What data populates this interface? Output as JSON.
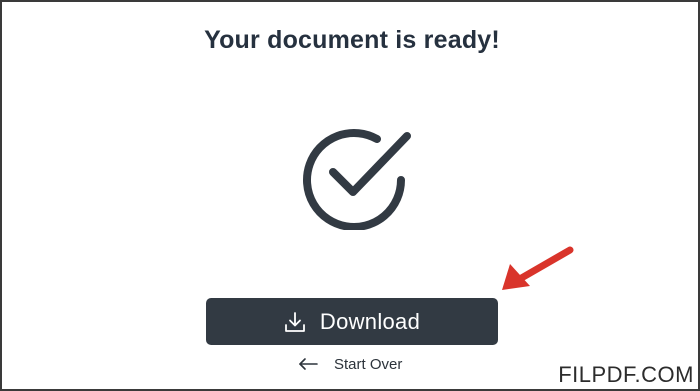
{
  "dialog": {
    "title": "Your document is ready!",
    "success_icon": "check-circle-icon"
  },
  "actions": {
    "download_label": "Download",
    "download_icon": "download-icon",
    "start_over_label": "Start Over",
    "start_over_icon": "arrow-left-icon"
  },
  "annotation": {
    "arrow_icon": "red-pointer-arrow",
    "arrow_color": "#d9342b"
  },
  "watermark": {
    "text": "FILPDF.COM"
  },
  "colors": {
    "button_bg": "#323a43",
    "text_dark": "#26313f",
    "icon_stroke": "#323a43"
  }
}
